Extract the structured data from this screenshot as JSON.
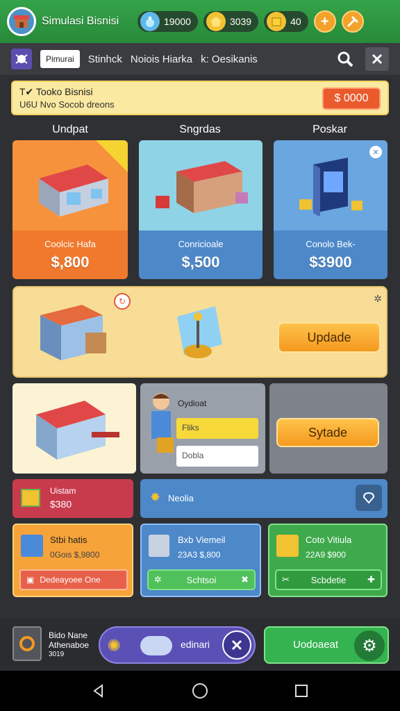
{
  "header": {
    "title": "Simulasi Bisnisi",
    "coins": "19000",
    "gold": "3039",
    "gems": "40",
    "add_label": "+",
    "settings_icon": "wrench-icon"
  },
  "nav": {
    "active_tab": "Pimurai",
    "tabs": [
      "Stinhck",
      "Noiois Hiarka",
      "k: Oesikanis"
    ]
  },
  "banner": {
    "title": "T✔ Tooko Bisnisi",
    "subtitle": "U6U  Nvo Socob dreons",
    "button": "$ 0000"
  },
  "sections": [
    "Undpat",
    "Sngrdas",
    "Poskar"
  ],
  "shops": [
    {
      "name": "Coolcic Hafa",
      "price": "$,800"
    },
    {
      "name": "Conricioale",
      "price": "$,500"
    },
    {
      "name": "Conolo Bek-",
      "price": "$3900"
    }
  ],
  "wide_panel": {
    "button": "Updade"
  },
  "staff_panel": {
    "title": "Oydioat",
    "option_1": "Fliks",
    "option_2": "Dobla"
  },
  "system_panel": {
    "button": "Sytade"
  },
  "alert_red": {
    "title": "Uistam",
    "value": "$380"
  },
  "alert_blue": {
    "title": "Neolia"
  },
  "small_cards": [
    {
      "title": "Stbi hatis",
      "value": "0Gois $,9800",
      "button": "Dedeayoee One"
    },
    {
      "title": "Bxb Viemeil",
      "value": "23A3  $,800",
      "button": "Schtsoi"
    },
    {
      "title": "Coto Vitiula",
      "value": "22A9 $900",
      "button": "Scbdetie"
    }
  ],
  "dock": {
    "profile_line1": "Bido Nane",
    "profile_line2": "Athenaboe",
    "profile_line3": "3019",
    "middle_label": "edinari",
    "green_button": "Uodoaeat"
  },
  "colors": {
    "green": "#35a349",
    "orange": "#f49a1f",
    "blue_card": "#4d88c9",
    "red_panel": "#c83b4d",
    "purple_dock": "#5a50b5"
  }
}
